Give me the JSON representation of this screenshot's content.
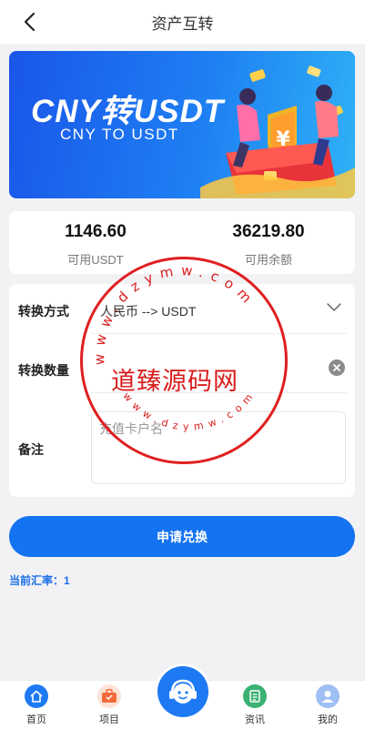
{
  "header": {
    "title": "资产互转"
  },
  "banner": {
    "title": "CNY转USDT",
    "subtitle": "CNY TO USDT"
  },
  "balances": [
    {
      "value": "1146.60",
      "label": "可用USDT"
    },
    {
      "value": "36219.80",
      "label": "可用余额"
    }
  ],
  "form": {
    "method_label": "转换方式",
    "method_value": "人民币 --> USDT",
    "quantity_label": "转换数量",
    "quantity_value": "",
    "remark_label": "备注",
    "remark_placeholder": "充值卡户名"
  },
  "submit_label": "申请兑换",
  "rate_text": "当前汇率：1",
  "watermark": {
    "text": "道臻源码网",
    "ring_text": "www.dzymw.com"
  },
  "tabbar": {
    "items": [
      {
        "label": "首页",
        "icon": "home-icon",
        "color": "#1d7af2"
      },
      {
        "label": "项目",
        "icon": "briefcase-icon",
        "color": "#f26b3a"
      },
      {
        "label": "",
        "icon": "support-icon",
        "color": "#1d7af2"
      },
      {
        "label": "资讯",
        "icon": "news-icon",
        "color": "#3bb272"
      },
      {
        "label": "我的",
        "icon": "user-icon",
        "color": "#6c9cf0"
      }
    ]
  }
}
